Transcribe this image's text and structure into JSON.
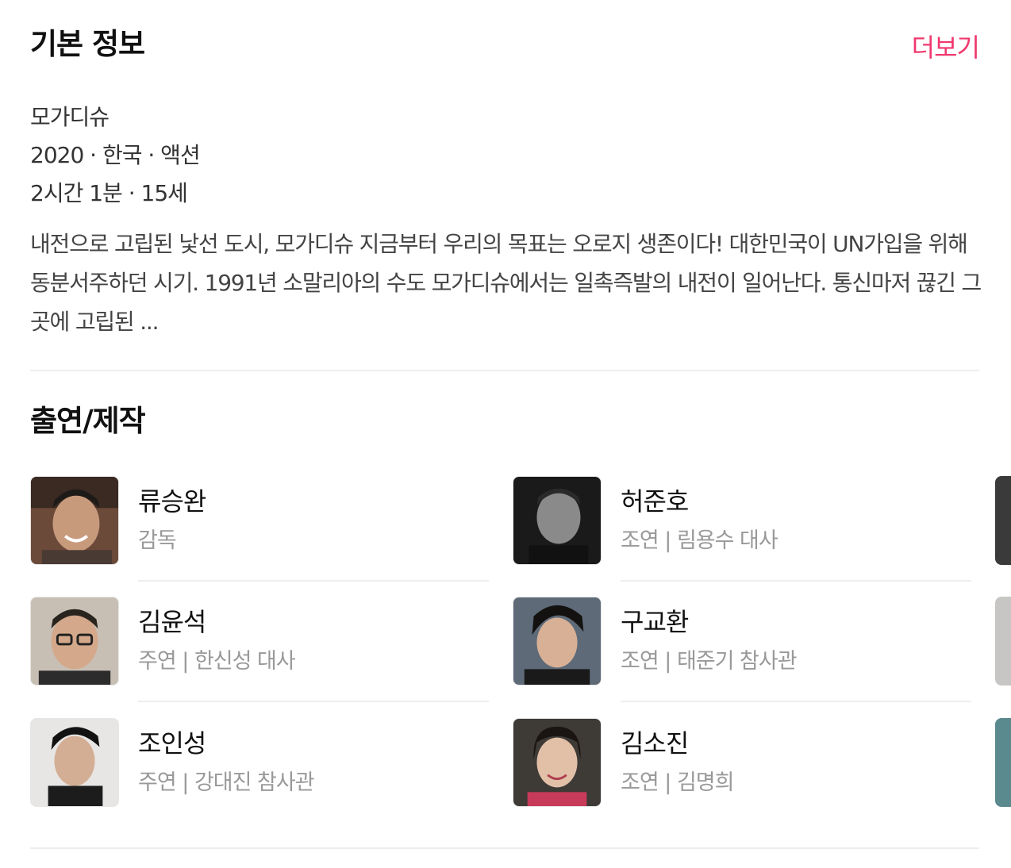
{
  "basic_info": {
    "title": "기본 정보",
    "more_label": "더보기",
    "movie_title": "모가디슈",
    "meta_line_1": "2020 · 한국 · 액션",
    "meta_line_2": "2시간 1분 · 15세",
    "synopsis": "내전으로 고립된 낯선 도시, 모가디슈 지금부터 우리의 목표는 오로지 생존이다! 대한민국이 UN가입을 위해 동분서주하던 시기. 1991년 소말리아의 수도 모가디슈에서는 일촉즉발의 내전이 일어난다. 통신마저 끊긴 그 곳에 고립된 ..."
  },
  "cast": {
    "title": "출연/제작",
    "items": [
      {
        "name": "류승완",
        "role": "감독"
      },
      {
        "name": "허준호",
        "role": "조연 | 림용수 대사"
      },
      {
        "name": "김윤석",
        "role": "주연 | 한신성 대사"
      },
      {
        "name": "구교환",
        "role": "조연 | 태준기 참사관"
      },
      {
        "name": "조인성",
        "role": "주연 | 강대진 참사관"
      },
      {
        "name": "김소진",
        "role": "조연 | 김명희"
      }
    ]
  },
  "colors": {
    "accent": "#f0386e",
    "text_primary": "#111111",
    "text_secondary": "#999999",
    "divider": "#eeeeee"
  }
}
